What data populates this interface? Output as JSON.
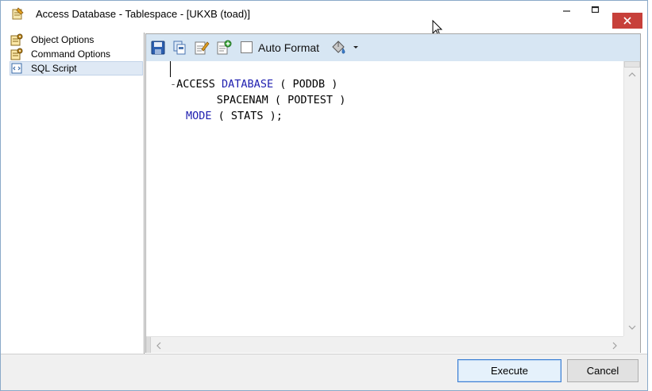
{
  "window": {
    "title": "Access Database - Tablespace - [UKXB (toad)]",
    "controls": {
      "minimize": "—",
      "maximize": "☐",
      "close": "✕"
    }
  },
  "nav": {
    "items": [
      {
        "label": "Object Options",
        "icon": "options-icon",
        "selected": false
      },
      {
        "label": "Command Options",
        "icon": "options-icon",
        "selected": false
      },
      {
        "label": "SQL Script",
        "icon": "sql-script-icon",
        "selected": true
      }
    ]
  },
  "toolbar": {
    "icons": [
      "save-icon",
      "copy-icon",
      "edit-script-icon",
      "add-script-icon"
    ],
    "auto_format_label": "Auto Format",
    "auto_format_checked": false,
    "format_icon": "paint-bucket-icon",
    "dropdown_icon": "chevron-down-icon"
  },
  "editor": {
    "lines": [
      {
        "prefix": "-",
        "t1": "ACCESS ",
        "k1": "DATABASE",
        "t2": " ( PODDB )"
      },
      {
        "prefix": "",
        "t1": "      SPACENAM ( PODTEST )",
        "k1": "",
        "t2": ""
      },
      {
        "prefix": "",
        "t1": "",
        "k1": "MODE",
        "t2": " ( STATS );"
      }
    ]
  },
  "footer": {
    "execute_label": "Execute",
    "cancel_label": "Cancel"
  },
  "colors": {
    "keyword": "#2020b0",
    "toolbar_bg": "#d7e6f3",
    "selection_bg": "#dfe9f5",
    "close_button": "#c7403a",
    "default_button_border": "#3c7fd4"
  }
}
